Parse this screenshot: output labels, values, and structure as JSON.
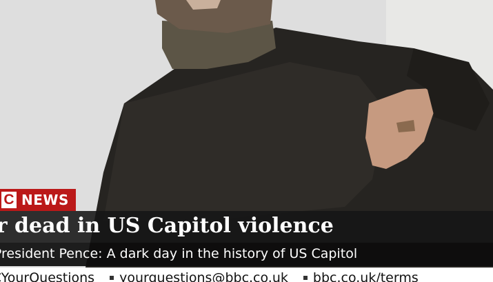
{
  "brand": {
    "logo_text": "C",
    "channel": "NEWS",
    "accent_color": "#bb1919"
  },
  "headline": "ur dead in US Capitol violence",
  "subheadline": "-President Pence: A dark day in the history of US Capitol",
  "ticker": {
    "items": [
      "BCYourQuestions",
      "yourquestions@bbc.co.uk",
      "bbc.co.uk/terms"
    ]
  }
}
